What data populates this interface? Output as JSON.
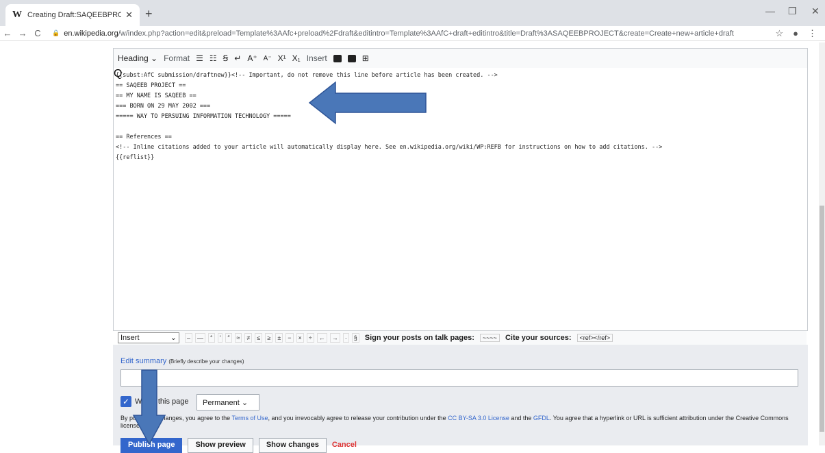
{
  "browser": {
    "tab_title": "Creating Draft:SAQEEBPROJECT",
    "tab_favicon": "W",
    "url_host": "en.wikipedia.org",
    "url_path": "/w/index.php?action=edit&preload=Template%3AAfc+preload%2Fdraft&editintro=Template%3AAfC+draft+editintro&title=Draft%3ASAQEEBPROJECT&create=Create+new+article+draft"
  },
  "toolbar": {
    "heading": "Heading",
    "format": "Format",
    "insert": "Insert",
    "superscript": "X",
    "subscript": "X"
  },
  "editor_text": {
    "line1": "{{subst:AfC submission/draftnew}}<!-- Important, do not remove this line before article has been created. -->",
    "line2": "== SAQEEB PROJECT ==",
    "line3": "== MY NAME IS SAQEEB ==",
    "line4": "=== BORN ON 29 MAY 2002 ===",
    "line5": "===== WAY TO PERSUING INFORMATION TECHNOLOGY =====",
    "line6": "",
    "line7": "== References ==",
    "line8": "<!-- Inline citations added to your article will automatically display here. See en.wikipedia.org/wiki/WP:REFB for instructions on how to add citations. -->",
    "line9": "{{reflist}}"
  },
  "special_chars": {
    "insert_select": "Insert",
    "chars": [
      "–",
      "—",
      "°",
      "′",
      "″",
      "≈",
      "≠",
      "≤",
      "≥",
      "±",
      "−",
      "×",
      "÷",
      "←",
      "→",
      "·",
      "§"
    ],
    "sign_label": "Sign your posts on talk pages:",
    "sign_code": "~~~~",
    "cite_label": "Cite your sources:",
    "cite_code": "<ref></ref>"
  },
  "summary": {
    "label": "Edit summary",
    "hint": "(Briefly describe your changes)",
    "watch_label": "Watch this page",
    "watch_select": "Permanent",
    "license_1": "By publishing changes, you agree to the ",
    "terms_link": "Terms of Use",
    "license_2": ", and you irrevocably agree to release your contribution under the ",
    "cc_link": "CC BY-SA 3.0 License",
    "license_3": " and the ",
    "gfdl_link": "GFDL",
    "license_4": ". You agree that a hyperlink or URL is sufficient attribution under the Creative Commons license.",
    "publish": "Publish page",
    "preview": "Show preview",
    "changes": "Show changes",
    "cancel": "Cancel"
  },
  "colors": {
    "accent": "#3366cc",
    "arrow": "#4a77b8"
  }
}
